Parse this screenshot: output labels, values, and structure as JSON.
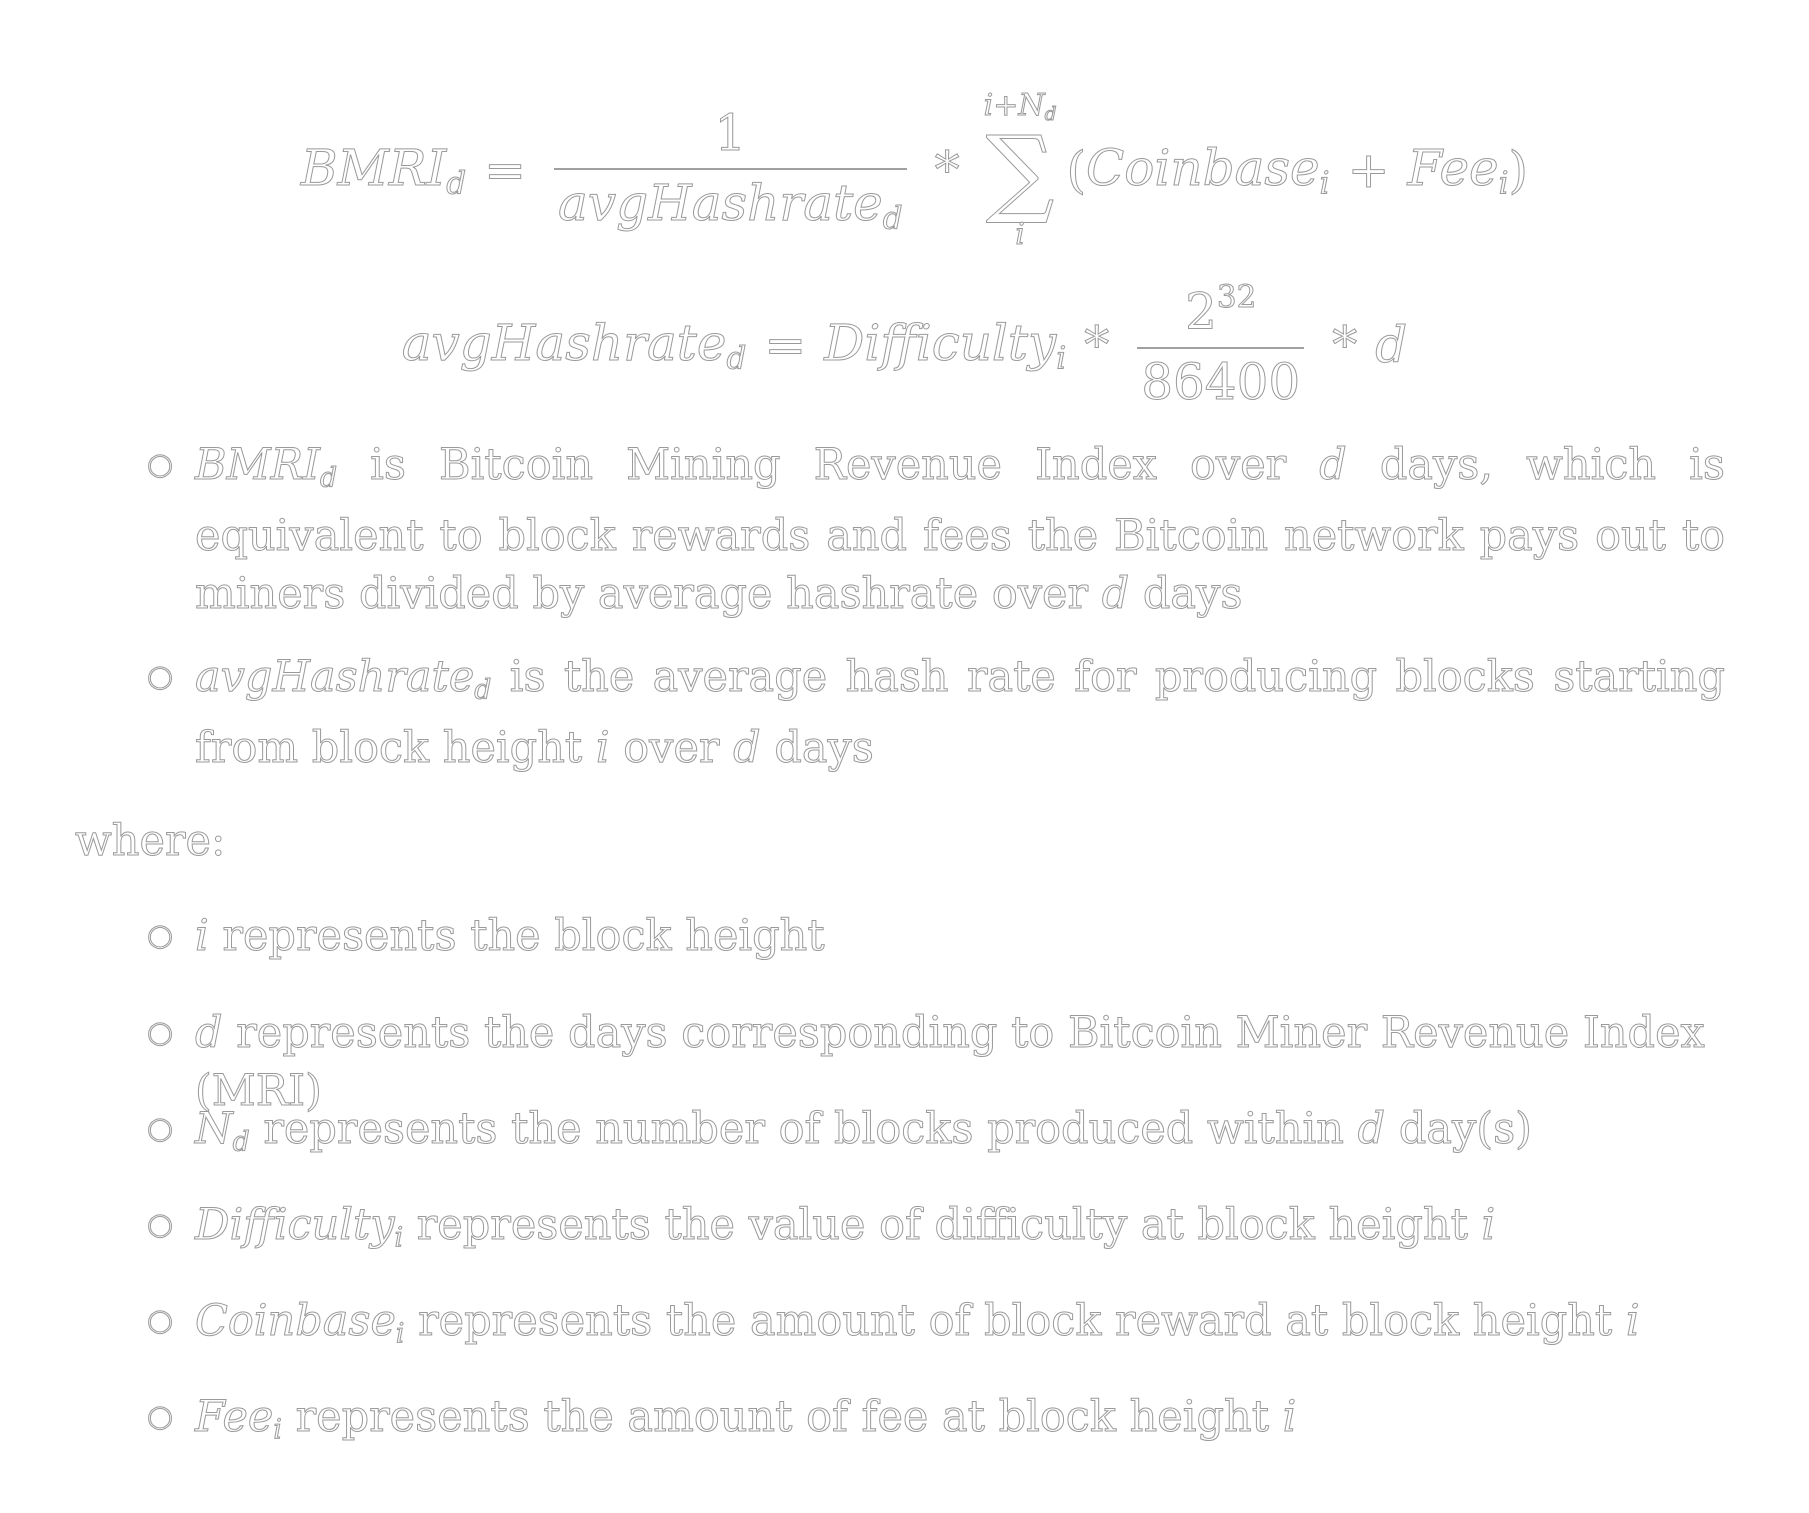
{
  "equations": {
    "eq1": {
      "lhs": "BMRI",
      "lhs_sub": "d",
      "equals": "=",
      "frac_num": "1",
      "frac_den": "avgHashrate",
      "frac_den_sub": "d",
      "times": "*",
      "sum_upper": "i+N",
      "sum_upper_sub": "d",
      "sum_symbol": "∑",
      "sum_lower": "i",
      "open_paren": "(",
      "term1": "Coinbase",
      "term1_sub": "i",
      "plus": "+",
      "term2": "Fee",
      "term2_sub": "i",
      "close_paren": ")"
    },
    "eq2": {
      "lhs": "avgHashrate",
      "lhs_sub": "d",
      "equals": "=",
      "var": "Difficulty",
      "var_sub": "i",
      "times": "*",
      "frac_num_base": "2",
      "frac_num_exp": "32",
      "frac_den": "86400",
      "times2": "*",
      "tail": "d"
    }
  },
  "definitions": [
    {
      "var": "BMRI",
      "var_sub": "d",
      "pre": " is Bitcoin Mining Revenue Index over ",
      "v2": "d",
      "post": " days, which is equivalent to block rewards and fees the Bitcoin network pays out to miners divided by average hashrate over ",
      "v3": "d",
      "end": " days"
    },
    {
      "var": "avgHashrate",
      "var_sub": "d",
      "pre": " is the average hash rate for producing blocks starting from block height ",
      "v2": "i",
      "post": " over ",
      "v3": "d",
      "end": " days"
    }
  ],
  "where_label": "where:",
  "where_items": [
    {
      "var": "i",
      "var_sub": "",
      "text": " represents the block height",
      "tail_var": ""
    },
    {
      "var": "d",
      "var_sub": "",
      "text": " represents the days corresponding to Bitcoin Miner Revenue Index (MRI)",
      "tail_var": ""
    },
    {
      "var": "N",
      "var_sub": "d",
      "text": " represents the number of blocks produced within ",
      "tail_var": "d",
      "tail_text": " day(s)"
    },
    {
      "var": "Difficulty",
      "var_sub": "i",
      "text": " represents the value of difficulty at block height ",
      "tail_var": "i"
    },
    {
      "var": "Coinbase",
      "var_sub": "i",
      "text": " represents the amount of block reward at block height ",
      "tail_var": "i"
    },
    {
      "var": "Fee",
      "var_sub": "i",
      "text": " represents the amount of fee at block height ",
      "tail_var": "i"
    }
  ],
  "bullet_glyph": "○"
}
